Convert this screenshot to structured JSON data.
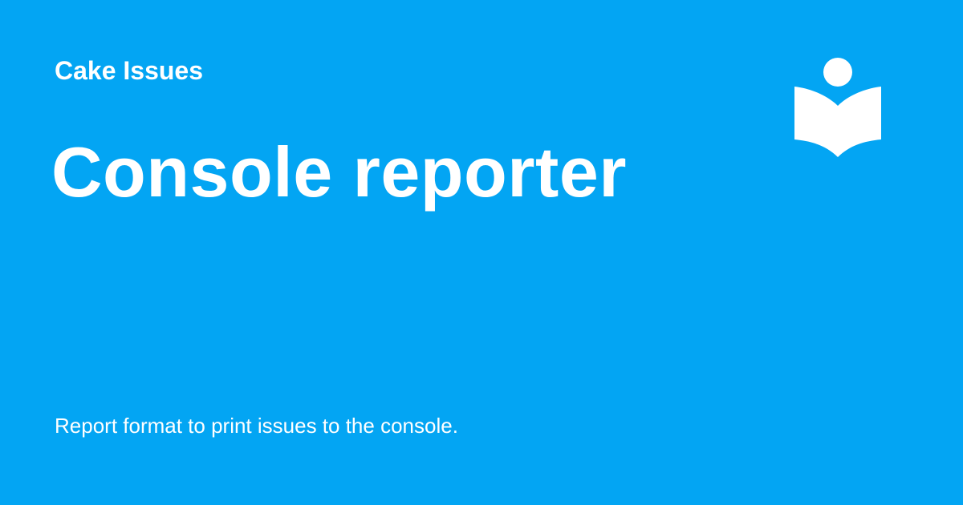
{
  "theme": {
    "background_color": "#03a5f3",
    "text_color": "#ffffff"
  },
  "site": {
    "name": "Cake Issues"
  },
  "page": {
    "title": "Console reporter",
    "description": "Report format to print issues to the console."
  },
  "logo": {
    "icon": "reader-book-icon"
  }
}
